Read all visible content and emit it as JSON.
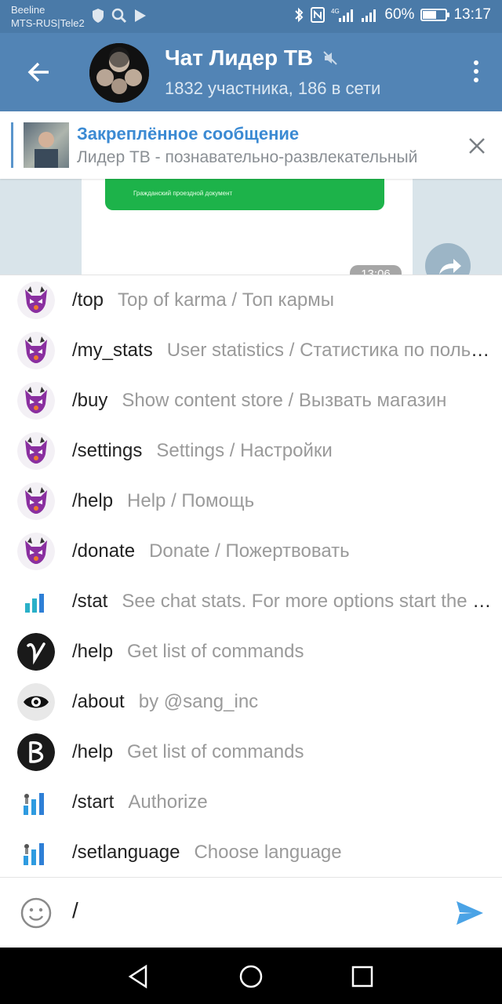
{
  "status_bar": {
    "carrier1": "Beeline",
    "carrier2": "MTS-RUS|Tele2",
    "battery": "60%",
    "battery_level": 0.6,
    "time": "13:17",
    "network": "4G"
  },
  "header": {
    "title": "Чат Лидер ТВ",
    "subtitle": "1832 участника, 186 в сети",
    "muted": true
  },
  "pinned": {
    "title": "Закреплённое сообщение",
    "text": "Лидер ТВ - познавательно-развлекательный"
  },
  "chat": {
    "card_text": "Гражданский проездной документ",
    "time": "13:06"
  },
  "commands": [
    {
      "cmd": "/top",
      "desc": "Top of karma / Топ кармы",
      "icon": "lynx-bot-icon"
    },
    {
      "cmd": "/my_stats",
      "desc": "User statistics / Статистика по пользователю",
      "icon": "lynx-bot-icon"
    },
    {
      "cmd": "/buy",
      "desc": "Show content store / Вызвать магазин",
      "icon": "lynx-bot-icon"
    },
    {
      "cmd": "/settings",
      "desc": "Settings / Настройки",
      "icon": "lynx-bot-icon"
    },
    {
      "cmd": "/help",
      "desc": "Help / Помощь",
      "icon": "lynx-bot-icon"
    },
    {
      "cmd": "/donate",
      "desc": "Donate / Пожертвовать",
      "icon": "lynx-bot-icon"
    },
    {
      "cmd": "/stat",
      "desc": "See chat stats. For more options start the bot",
      "icon": "bar-chart-icon"
    },
    {
      "cmd": "/help",
      "desc": "Get list of commands",
      "icon": "v-logo-icon"
    },
    {
      "cmd": "/about",
      "desc": "by @sang_inc",
      "icon": "eye-icon"
    },
    {
      "cmd": "/help",
      "desc": "Get list of commands",
      "icon": "b-logo-icon"
    },
    {
      "cmd": "/start",
      "desc": "Authorize",
      "icon": "stats-bot-icon"
    },
    {
      "cmd": "/setlanguage",
      "desc": "Choose language",
      "icon": "stats-bot-icon"
    }
  ],
  "input": {
    "value": "/"
  },
  "colors": {
    "header": "#5284b5",
    "status_bar": "#4a7aa8",
    "accent": "#3b8ad3",
    "send": "#4aa3e6"
  }
}
